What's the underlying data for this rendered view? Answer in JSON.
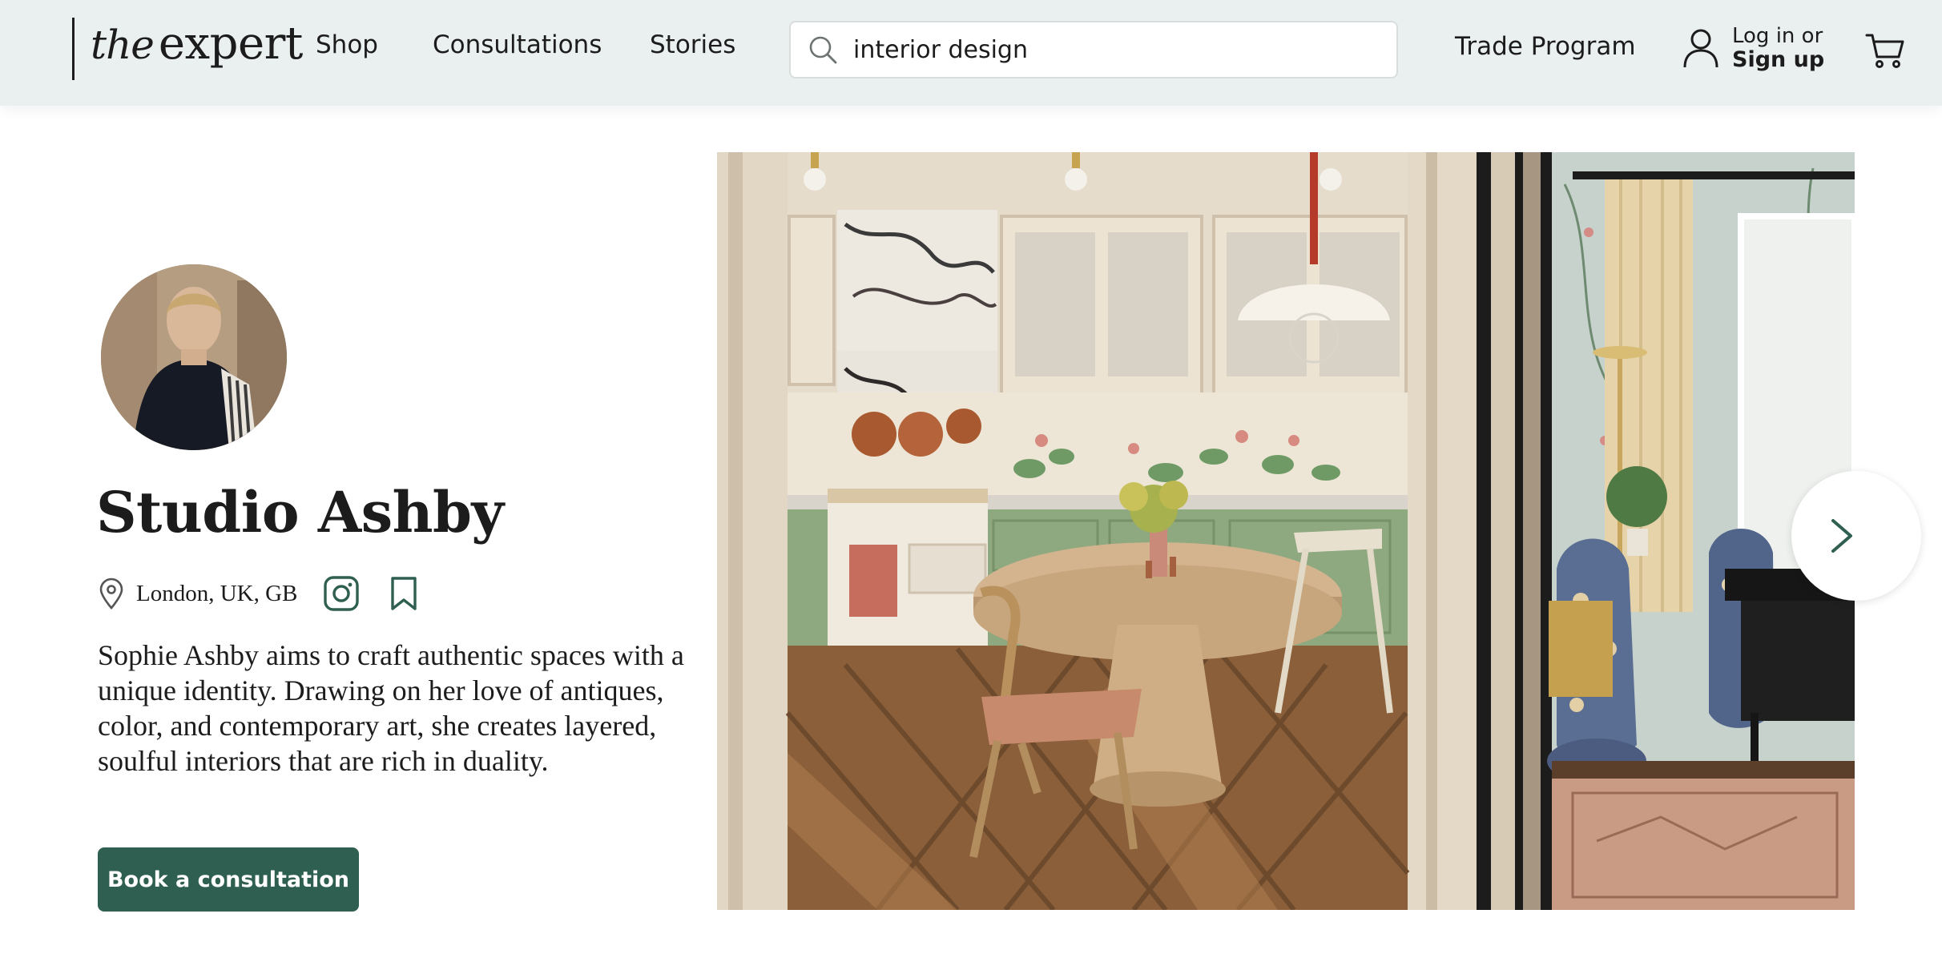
{
  "header": {
    "logo": {
      "the": "the",
      "expert": "expert"
    },
    "nav": {
      "shop": "Shop",
      "consultations": "Consultations",
      "stories": "Stories"
    },
    "search": {
      "value": "interior design",
      "icon": "search-icon"
    },
    "trade_program": "Trade Program",
    "account": {
      "login": "Log in or",
      "signup": "Sign up",
      "icon": "user-icon"
    },
    "cart_icon": "cart-icon"
  },
  "profile": {
    "name": "Studio Ashby",
    "location": "London, UK, GB",
    "bio": "Sophie Ashby aims to craft authentic spaces with a unique identity. Drawing on her love of antiques, color, and contemporary art, she creates layered, soulful interiors that are rich in duality.",
    "cta": "Book a consultation",
    "icons": [
      "pin-icon",
      "instagram-icon",
      "bookmark-icon"
    ]
  },
  "gallery": {
    "photos": [
      "kitchen-dining-photo",
      "living-room-photo"
    ],
    "next_icon": "chevron-right-icon"
  },
  "colors": {
    "header_bg": "#eaf0ef",
    "brand_green": "#2f5f50",
    "text": "#1c1c1c"
  }
}
